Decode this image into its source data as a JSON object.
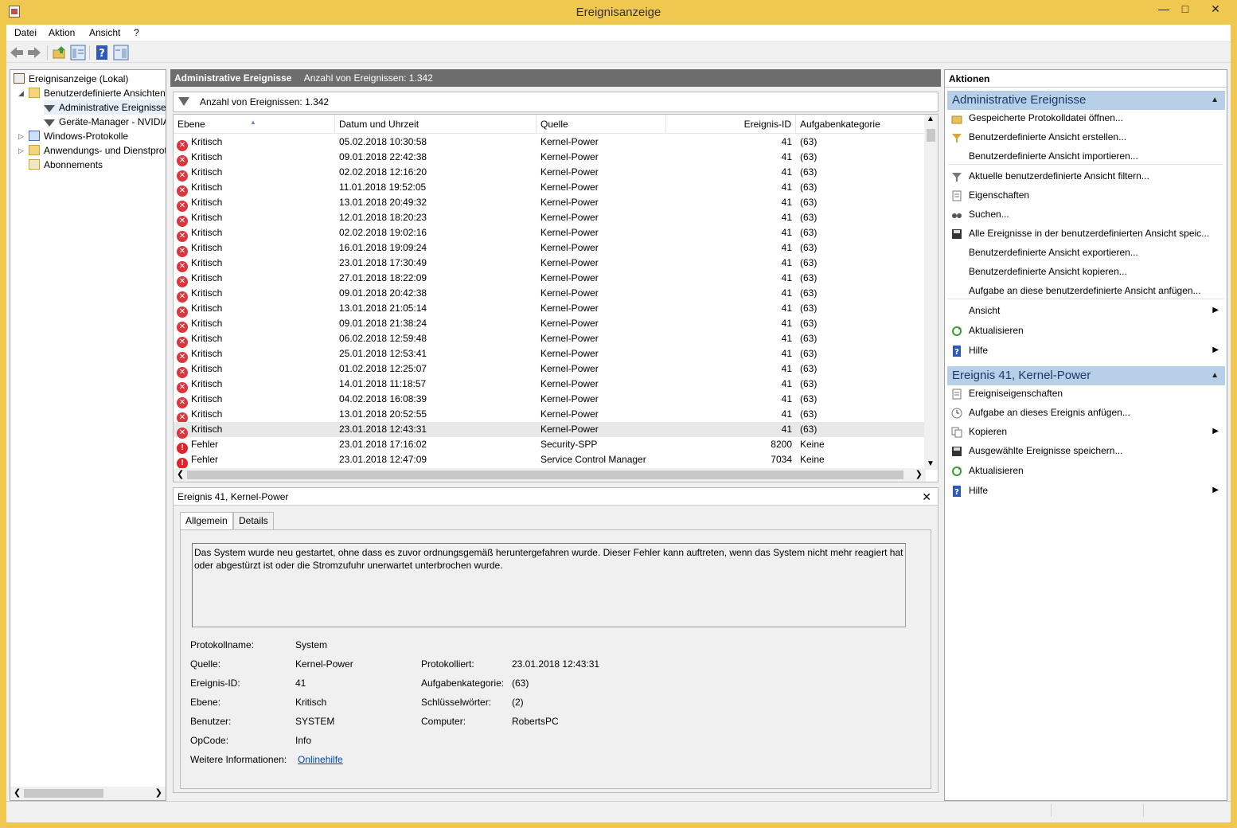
{
  "window": {
    "title": "Ereignisanzeige"
  },
  "menu": [
    "Datei",
    "Aktion",
    "Ansicht",
    "?"
  ],
  "tree": {
    "root": "Ereignisanzeige (Lokal)",
    "custom_views": "Benutzerdefinierte Ansichten",
    "admin_events": "Administrative Ereignisse",
    "device_manager": "Geräte-Manager - NVIDIA",
    "windows_logs": "Windows-Protokolle",
    "app_services": "Anwendungs- und Dienstprotokolle",
    "subscriptions": "Abonnements"
  },
  "center": {
    "header_title": "Administrative Ereignisse",
    "header_count": "Anzahl von Ereignissen: 1.342",
    "filter_count": "Anzahl von Ereignissen: 1.342",
    "columns": [
      "Ebene",
      "Datum und Uhrzeit",
      "Quelle",
      "Ereignis-ID",
      "Aufgabenkategorie"
    ],
    "rows": [
      {
        "level": "Kritisch",
        "date": "05.02.2018 10:30:58",
        "source": "Kernel-Power",
        "id": "41",
        "cat": "(63)"
      },
      {
        "level": "Kritisch",
        "date": "09.01.2018 22:42:38",
        "source": "Kernel-Power",
        "id": "41",
        "cat": "(63)"
      },
      {
        "level": "Kritisch",
        "date": "02.02.2018 12:16:20",
        "source": "Kernel-Power",
        "id": "41",
        "cat": "(63)"
      },
      {
        "level": "Kritisch",
        "date": "11.01.2018 19:52:05",
        "source": "Kernel-Power",
        "id": "41",
        "cat": "(63)"
      },
      {
        "level": "Kritisch",
        "date": "13.01.2018 20:49:32",
        "source": "Kernel-Power",
        "id": "41",
        "cat": "(63)"
      },
      {
        "level": "Kritisch",
        "date": "12.01.2018 18:20:23",
        "source": "Kernel-Power",
        "id": "41",
        "cat": "(63)"
      },
      {
        "level": "Kritisch",
        "date": "02.02.2018 19:02:16",
        "source": "Kernel-Power",
        "id": "41",
        "cat": "(63)"
      },
      {
        "level": "Kritisch",
        "date": "16.01.2018 19:09:24",
        "source": "Kernel-Power",
        "id": "41",
        "cat": "(63)"
      },
      {
        "level": "Kritisch",
        "date": "23.01.2018 17:30:49",
        "source": "Kernel-Power",
        "id": "41",
        "cat": "(63)"
      },
      {
        "level": "Kritisch",
        "date": "27.01.2018 18:22:09",
        "source": "Kernel-Power",
        "id": "41",
        "cat": "(63)"
      },
      {
        "level": "Kritisch",
        "date": "09.01.2018 20:42:38",
        "source": "Kernel-Power",
        "id": "41",
        "cat": "(63)"
      },
      {
        "level": "Kritisch",
        "date": "13.01.2018 21:05:14",
        "source": "Kernel-Power",
        "id": "41",
        "cat": "(63)"
      },
      {
        "level": "Kritisch",
        "date": "09.01.2018 21:38:24",
        "source": "Kernel-Power",
        "id": "41",
        "cat": "(63)"
      },
      {
        "level": "Kritisch",
        "date": "06.02.2018 12:59:48",
        "source": "Kernel-Power",
        "id": "41",
        "cat": "(63)"
      },
      {
        "level": "Kritisch",
        "date": "25.01.2018 12:53:41",
        "source": "Kernel-Power",
        "id": "41",
        "cat": "(63)"
      },
      {
        "level": "Kritisch",
        "date": "01.02.2018 12:25:07",
        "source": "Kernel-Power",
        "id": "41",
        "cat": "(63)"
      },
      {
        "level": "Kritisch",
        "date": "14.01.2018 11:18:57",
        "source": "Kernel-Power",
        "id": "41",
        "cat": "(63)"
      },
      {
        "level": "Kritisch",
        "date": "04.02.2018 16:08:39",
        "source": "Kernel-Power",
        "id": "41",
        "cat": "(63)"
      },
      {
        "level": "Kritisch",
        "date": "13.01.2018 20:52:55",
        "source": "Kernel-Power",
        "id": "41",
        "cat": "(63)"
      },
      {
        "level": "Kritisch",
        "date": "23.01.2018 12:43:31",
        "source": "Kernel-Power",
        "id": "41",
        "cat": "(63)"
      },
      {
        "level": "Fehler",
        "date": "23.01.2018 17:16:02",
        "source": "Security-SPP",
        "id": "8200",
        "cat": "Keine"
      },
      {
        "level": "Fehler",
        "date": "23.01.2018 12:47:09",
        "source": "Service Control Manager",
        "id": "7034",
        "cat": "Keine"
      }
    ],
    "selected_row": 19
  },
  "detail": {
    "title": "Ereignis 41, Kernel-Power",
    "tab_general": "Allgemein",
    "tab_details": "Details",
    "description": "Das System wurde neu gestartet, ohne dass es zuvor ordnungsgemäß heruntergefahren wurde. Dieser Fehler kann auftreten, wenn das System nicht mehr reagiert hat oder abgestürzt ist oder die Stromzufuhr unerwartet unterbrochen wurde.",
    "labels": {
      "log_name": "Protokollname:",
      "source": "Quelle:",
      "event_id": "Ereignis-ID:",
      "level": "Ebene:",
      "user": "Benutzer:",
      "opcode": "OpCode:",
      "more_info": "Weitere Informationen:",
      "logged": "Protokolliert:",
      "task_category": "Aufgabenkategorie:",
      "keywords": "Schlüsselwörter:",
      "computer": "Computer:"
    },
    "values": {
      "log_name": "System",
      "source": "Kernel-Power",
      "event_id": "41",
      "level": "Kritisch",
      "user": "SYSTEM",
      "opcode": "Info",
      "more_info": "Onlinehilfe",
      "logged": "23.01.2018 12:43:31",
      "task_category": "(63)",
      "keywords": "(2)",
      "computer": "RobertsPC"
    }
  },
  "actions": {
    "title": "Aktionen",
    "section1": "Administrative Ereignisse",
    "section1_items": [
      "Gespeicherte Protokolldatei öffnen...",
      "Benutzerdefinierte Ansicht erstellen...",
      "Benutzerdefinierte Ansicht importieren...",
      "Aktuelle benutzerdefinierte Ansicht filtern...",
      "Eigenschaften",
      "Suchen...",
      "Alle Ereignisse in der benutzerdefinierten Ansicht speic...",
      "Benutzerdefinierte Ansicht exportieren...",
      "Benutzerdefinierte Ansicht kopieren...",
      "Aufgabe an diese benutzerdefinierte Ansicht anfügen...",
      "Ansicht",
      "Aktualisieren",
      "Hilfe"
    ],
    "section2": "Ereignis 41, Kernel-Power",
    "section2_items": [
      "Ereigniseigenschaften",
      "Aufgabe an dieses Ereignis anfügen...",
      "Kopieren",
      "Ausgewählte Ereignisse speichern...",
      "Aktualisieren",
      "Hilfe"
    ]
  },
  "colors": {
    "title_bar": "#f0c850",
    "header_gray": "#6d6d6d",
    "section_blue": "#b8cfe8",
    "critical_red": "#d9363e"
  }
}
